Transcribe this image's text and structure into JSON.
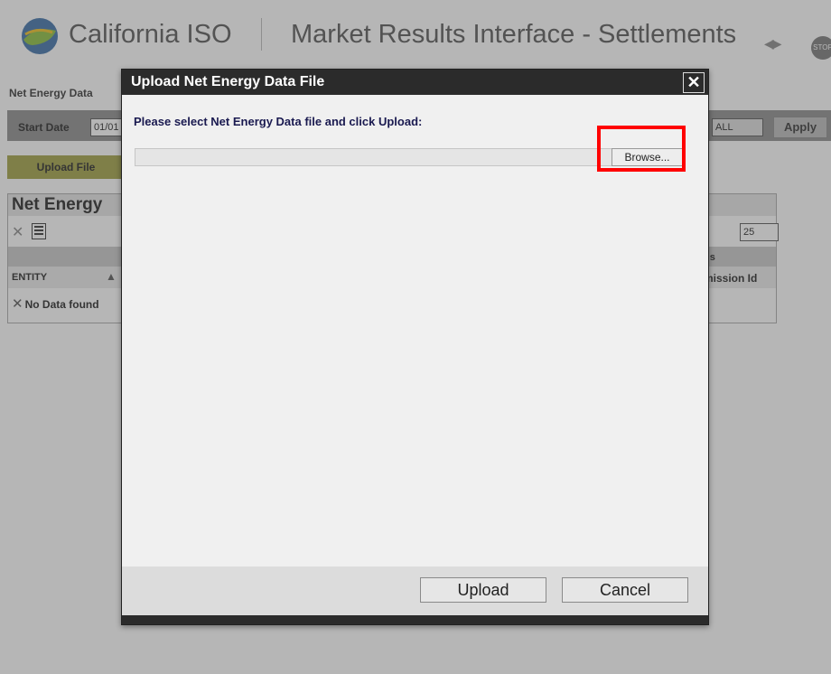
{
  "header": {
    "brand": "California ISO",
    "app_title": "Market Results Interface - Settlements",
    "stop_label": "STOP",
    "nav_arrows": "◀▶"
  },
  "breadcrumb": "Net Energy Data",
  "filters": {
    "start_date_label": "Start Date",
    "start_date_value": "01/01",
    "select_value": "ALL",
    "apply_label": "Apply"
  },
  "upload_file_label": "Upload File",
  "results": {
    "title": "Net Energy",
    "page_size": "25",
    "status_col": "us",
    "entity_col": "ENTITY",
    "submission_col": "mission Id",
    "no_data": "No Data found"
  },
  "dialog": {
    "title": "Upload Net Energy Data File",
    "close": "✕",
    "prompt": "Please select Net Energy Data file and click Upload:",
    "file_path_value": "",
    "browse_label": "Browse...",
    "upload_label": "Upload",
    "cancel_label": "Cancel"
  },
  "colors": {
    "titlebar": "#2b2b2b",
    "highlight": "#ff0000",
    "upload_file_btn": "#a0a042",
    "filterbar": "#8c8c8c"
  }
}
